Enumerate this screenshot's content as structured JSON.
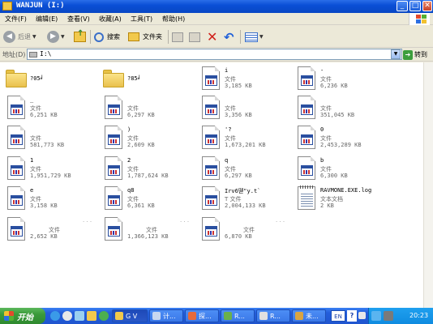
{
  "window": {
    "title": "WANJUN (I:)",
    "controls": {
      "minimize": "_",
      "maximize": "□",
      "close": "✕"
    }
  },
  "menu": [
    "文件(F)",
    "编辑(E)",
    "查看(V)",
    "收藏(A)",
    "工具(T)",
    "帮助(H)"
  ],
  "toolbar": {
    "back_label": "后退",
    "forward_label": "",
    "search_label": "搜索",
    "folders_label": "文件夹"
  },
  "address": {
    "label": "地址(D)",
    "value": "I:\\",
    "go_label": "转到"
  },
  "items": [
    {
      "kind": "folder",
      "name": "?05╛",
      "type": "",
      "size": ""
    },
    {
      "kind": "folder",
      "name": "?85╛",
      "type": "",
      "size": ""
    },
    {
      "kind": "file",
      "name": "i",
      "type": "文件",
      "size": "3,185 KB"
    },
    {
      "kind": "file",
      "name": "-",
      "type": "文件",
      "size": "6,236 KB"
    },
    {
      "kind": "file",
      "name": "_",
      "type": "文件",
      "size": "6,251 KB"
    },
    {
      "kind": "file",
      "name": "",
      "type": "文件",
      "size": "6,297 KB"
    },
    {
      "kind": "file",
      "name": "",
      "type": "文件",
      "size": "3,356 KB"
    },
    {
      "kind": "file",
      "name": "",
      "type": "文件",
      "size": "351,045 KB"
    },
    {
      "kind": "file",
      "name": "",
      "type": "文件",
      "size": "581,773 KB"
    },
    {
      "kind": "file",
      "name": ")",
      "type": "文件",
      "size": "2,609 KB"
    },
    {
      "kind": "file",
      "name": "'?",
      "type": "文件",
      "size": "1,673,201 KB"
    },
    {
      "kind": "file",
      "name": "0",
      "type": "文件",
      "size": "2,453,289 KB"
    },
    {
      "kind": "file",
      "name": "1",
      "type": "文件",
      "size": "1,951,729 KB"
    },
    {
      "kind": "file",
      "name": "2",
      "type": "文件",
      "size": "1,787,624 KB"
    },
    {
      "kind": "file",
      "name": "q",
      "type": "文件",
      "size": "6,297 KB"
    },
    {
      "kind": "file",
      "name": "b",
      "type": "文件",
      "size": "6,300 KB"
    },
    {
      "kind": "file",
      "name": "e",
      "type": "文件",
      "size": "3,158 KB"
    },
    {
      "kind": "file",
      "name": "q8",
      "type": "文件",
      "size": "6,361 KB"
    },
    {
      "kind": "file",
      "name": "Irv6뗃\"y.t`",
      "type": "T 文件",
      "size": "2,004,133 KB"
    },
    {
      "kind": "text",
      "name": "RAVMONE.EXE.log",
      "type": "文本文档",
      "size": "2 KB"
    },
    {
      "kind": "file",
      "name": "",
      "type": "文件",
      "size": "2,652 KB"
    },
    {
      "kind": "file",
      "name": "",
      "type": "文件",
      "size": "1,366,123 KB"
    },
    {
      "kind": "file",
      "name": "",
      "type": "文件",
      "size": "6,870 KB"
    }
  ],
  "taskbar": {
    "start_label": "开始",
    "tasks": [
      {
        "label": "G V",
        "icon": "folder-icon"
      },
      {
        "label": "计...",
        "icon": "computer-icon"
      },
      {
        "label": "探...",
        "icon": "explorer-icon"
      },
      {
        "label": "R...",
        "icon": "app-icon"
      },
      {
        "label": "R...",
        "icon": "app-icon"
      },
      {
        "label": "未...",
        "icon": "app-icon"
      }
    ],
    "lang": "EN",
    "clock": "20:23"
  }
}
